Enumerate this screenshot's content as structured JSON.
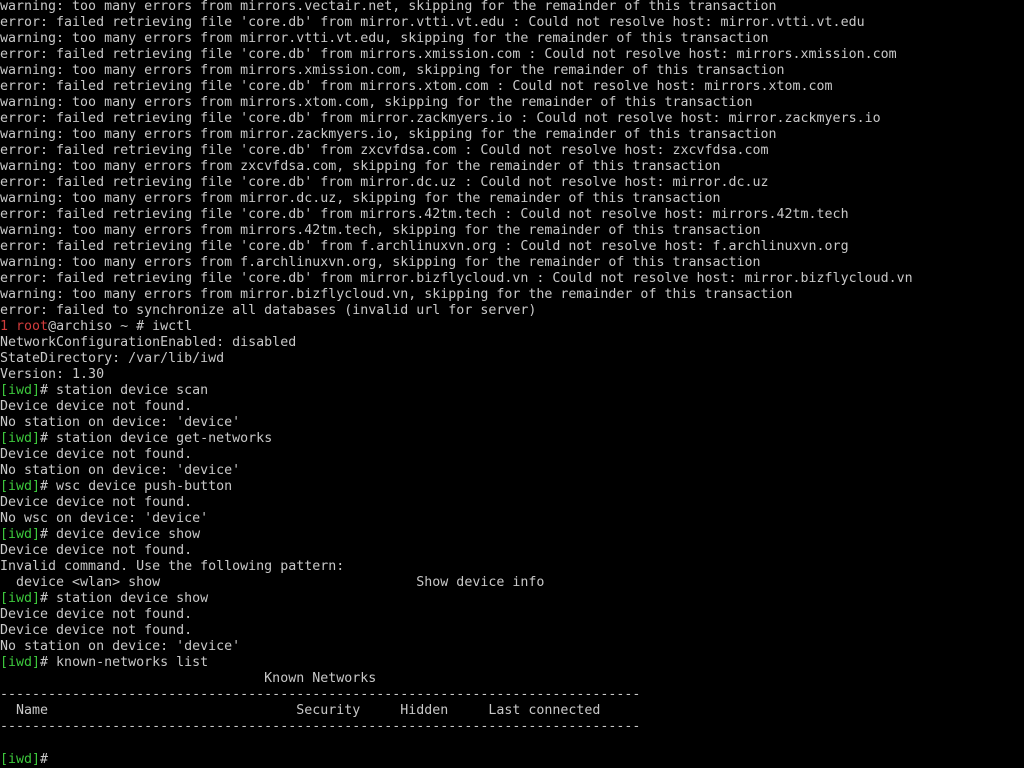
{
  "terminal": {
    "lines": [
      {
        "kind": "plain",
        "text": "warning: too many errors from mirrors.vectair.net, skipping for the remainder of this transaction"
      },
      {
        "kind": "plain",
        "text": "error: failed retrieving file 'core.db' from mirror.vtti.vt.edu : Could not resolve host: mirror.vtti.vt.edu"
      },
      {
        "kind": "plain",
        "text": "warning: too many errors from mirror.vtti.vt.edu, skipping for the remainder of this transaction"
      },
      {
        "kind": "plain",
        "text": "error: failed retrieving file 'core.db' from mirrors.xmission.com : Could not resolve host: mirrors.xmission.com"
      },
      {
        "kind": "plain",
        "text": "warning: too many errors from mirrors.xmission.com, skipping for the remainder of this transaction"
      },
      {
        "kind": "plain",
        "text": "error: failed retrieving file 'core.db' from mirrors.xtom.com : Could not resolve host: mirrors.xtom.com"
      },
      {
        "kind": "plain",
        "text": "warning: too many errors from mirrors.xtom.com, skipping for the remainder of this transaction"
      },
      {
        "kind": "plain",
        "text": "error: failed retrieving file 'core.db' from mirror.zackmyers.io : Could not resolve host: mirror.zackmyers.io"
      },
      {
        "kind": "plain",
        "text": "warning: too many errors from mirror.zackmyers.io, skipping for the remainder of this transaction"
      },
      {
        "kind": "plain",
        "text": "error: failed retrieving file 'core.db' from zxcvfdsa.com : Could not resolve host: zxcvfdsa.com"
      },
      {
        "kind": "plain",
        "text": "warning: too many errors from zxcvfdsa.com, skipping for the remainder of this transaction"
      },
      {
        "kind": "plain",
        "text": "error: failed retrieving file 'core.db' from mirror.dc.uz : Could not resolve host: mirror.dc.uz"
      },
      {
        "kind": "plain",
        "text": "warning: too many errors from mirror.dc.uz, skipping for the remainder of this transaction"
      },
      {
        "kind": "plain",
        "text": "error: failed retrieving file 'core.db' from mirrors.42tm.tech : Could not resolve host: mirrors.42tm.tech"
      },
      {
        "kind": "plain",
        "text": "warning: too many errors from mirrors.42tm.tech, skipping for the remainder of this transaction"
      },
      {
        "kind": "plain",
        "text": "error: failed retrieving file 'core.db' from f.archlinuxvn.org : Could not resolve host: f.archlinuxvn.org"
      },
      {
        "kind": "plain",
        "text": "warning: too many errors from f.archlinuxvn.org, skipping for the remainder of this transaction"
      },
      {
        "kind": "plain",
        "text": "error: failed retrieving file 'core.db' from mirror.bizflycloud.vn : Could not resolve host: mirror.bizflycloud.vn"
      },
      {
        "kind": "plain",
        "text": "warning: too many errors from mirror.bizflycloud.vn, skipping for the remainder of this transaction"
      },
      {
        "kind": "plain",
        "text": "error: failed to synchronize all databases (invalid url for server)"
      },
      {
        "kind": "shell-prompt",
        "status": "1",
        "user": "root",
        "host": "@archiso",
        "dir": " ~ ",
        "symbol": "#",
        "command": " iwctl"
      },
      {
        "kind": "plain",
        "text": "NetworkConfigurationEnabled: disabled"
      },
      {
        "kind": "plain",
        "text": "StateDirectory: /var/lib/iwd"
      },
      {
        "kind": "plain",
        "text": "Version: 1.30"
      },
      {
        "kind": "iwd-prompt",
        "prompt": "[iwd]",
        "symbol": "#",
        "command": " station device scan"
      },
      {
        "kind": "plain",
        "text": "Device device not found."
      },
      {
        "kind": "plain",
        "text": "No station on device: 'device'"
      },
      {
        "kind": "iwd-prompt",
        "prompt": "[iwd]",
        "symbol": "#",
        "command": " station device get-networks"
      },
      {
        "kind": "plain",
        "text": "Device device not found."
      },
      {
        "kind": "plain",
        "text": "No station on device: 'device'"
      },
      {
        "kind": "iwd-prompt",
        "prompt": "[iwd]",
        "symbol": "#",
        "command": " wsc device push-button"
      },
      {
        "kind": "plain",
        "text": "Device device not found."
      },
      {
        "kind": "plain",
        "text": "No wsc on device: 'device'"
      },
      {
        "kind": "iwd-prompt",
        "prompt": "[iwd]",
        "symbol": "#",
        "command": " device device show"
      },
      {
        "kind": "plain",
        "text": "Device device not found."
      },
      {
        "kind": "plain",
        "text": "Invalid command. Use the following pattern:"
      },
      {
        "kind": "plain",
        "text": "  device <wlan> show                                Show device info"
      },
      {
        "kind": "iwd-prompt",
        "prompt": "[iwd]",
        "symbol": "#",
        "command": " station device show"
      },
      {
        "kind": "plain",
        "text": "Device device not found."
      },
      {
        "kind": "plain",
        "text": "Device device not found."
      },
      {
        "kind": "plain",
        "text": "No station on device: 'device'"
      },
      {
        "kind": "iwd-prompt",
        "prompt": "[iwd]",
        "symbol": "#",
        "command": " known-networks list"
      },
      {
        "kind": "plain",
        "text": "                                 Known Networks"
      },
      {
        "kind": "plain",
        "text": "--------------------------------------------------------------------------------"
      },
      {
        "kind": "plain",
        "text": "  Name                               Security     Hidden     Last connected"
      },
      {
        "kind": "plain",
        "text": "--------------------------------------------------------------------------------"
      },
      {
        "kind": "plain",
        "text": ""
      },
      {
        "kind": "iwd-prompt",
        "prompt": "[iwd]",
        "symbol": "#",
        "command": ""
      }
    ]
  },
  "colors": {
    "background": "#000000",
    "text": "#c8c8c8",
    "prompt_green": "#3cc83c",
    "status_red": "#d23c3c"
  }
}
